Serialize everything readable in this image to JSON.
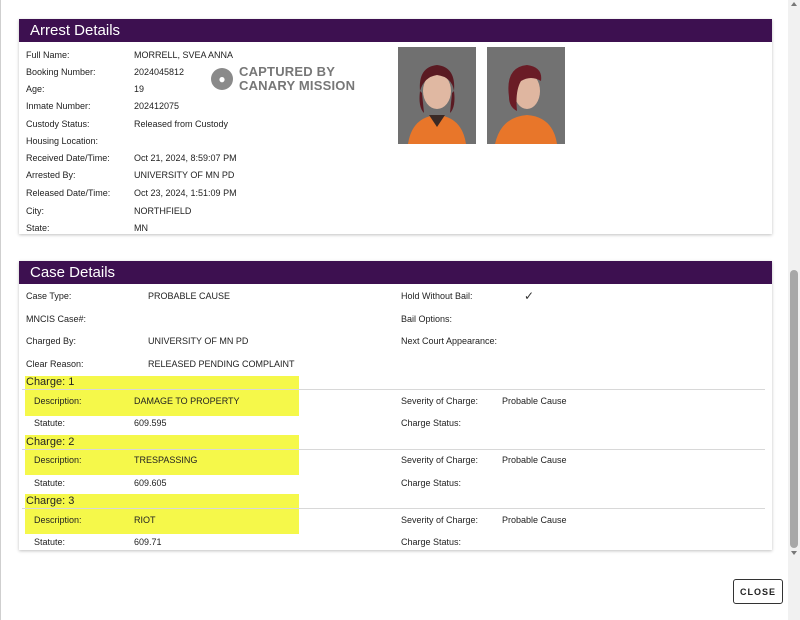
{
  "arrest": {
    "title": "Arrest Details",
    "fields": [
      {
        "label": "Full Name:",
        "value": "MORRELL, SVEA ANNA"
      },
      {
        "label": "Booking Number:",
        "value": "2024045812"
      },
      {
        "label": "Age:",
        "value": "19"
      },
      {
        "label": "Inmate Number:",
        "value": "202412075"
      },
      {
        "label": "Custody Status:",
        "value": "Released from Custody"
      },
      {
        "label": "Housing Location:",
        "value": ""
      },
      {
        "label": "Received Date/Time:",
        "value": "Oct 21, 2024, 8:59:07 PM"
      },
      {
        "label": "Arrested By:",
        "value": "UNIVERSITY OF MN PD"
      },
      {
        "label": "Released Date/Time:",
        "value": "Oct 23, 2024, 1:51:09 PM"
      },
      {
        "label": "City:",
        "value": "NORTHFIELD"
      },
      {
        "label": "State:",
        "value": "MN"
      }
    ],
    "watermark": {
      "line1": "CAPTURED BY",
      "line2": "CANARY MISSION"
    }
  },
  "case": {
    "title": "Case Details",
    "left": [
      {
        "label": "Case Type:",
        "value": "PROBABLE CAUSE"
      },
      {
        "label": "MNCIS Case#:",
        "value": ""
      },
      {
        "label": "Charged By:",
        "value": "UNIVERSITY OF MN PD"
      },
      {
        "label": "Clear Reason:",
        "value": "RELEASED PENDING COMPLAINT"
      }
    ],
    "right": [
      {
        "label": "Hold Without Bail:",
        "value": "✓"
      },
      {
        "label": "Bail Options:",
        "value": ""
      },
      {
        "label": "Next Court Appearance:",
        "value": ""
      }
    ],
    "charges": [
      {
        "title": "Charge: 1",
        "description_label": "Description:",
        "description": "DAMAGE TO PROPERTY",
        "statute_label": "Statute:",
        "statute": "609.595",
        "severity_label": "Severity of Charge:",
        "severity": "Probable Cause",
        "status_label": "Charge Status:",
        "status": ""
      },
      {
        "title": "Charge: 2",
        "description_label": "Description:",
        "description": "TRESPASSING",
        "statute_label": "Statute:",
        "statute": "609.605",
        "severity_label": "Severity of Charge:",
        "severity": "Probable Cause",
        "status_label": "Charge Status:",
        "status": ""
      },
      {
        "title": "Charge: 3",
        "description_label": "Description:",
        "description": "RIOT",
        "statute_label": "Statute:",
        "statute": "609.71",
        "severity_label": "Severity of Charge:",
        "severity": "Probable Cause",
        "status_label": "Charge Status:",
        "status": ""
      }
    ]
  },
  "close_label": "CLOSE",
  "colors": {
    "header_bg": "#3d1050",
    "highlight": "#f5f84a"
  }
}
